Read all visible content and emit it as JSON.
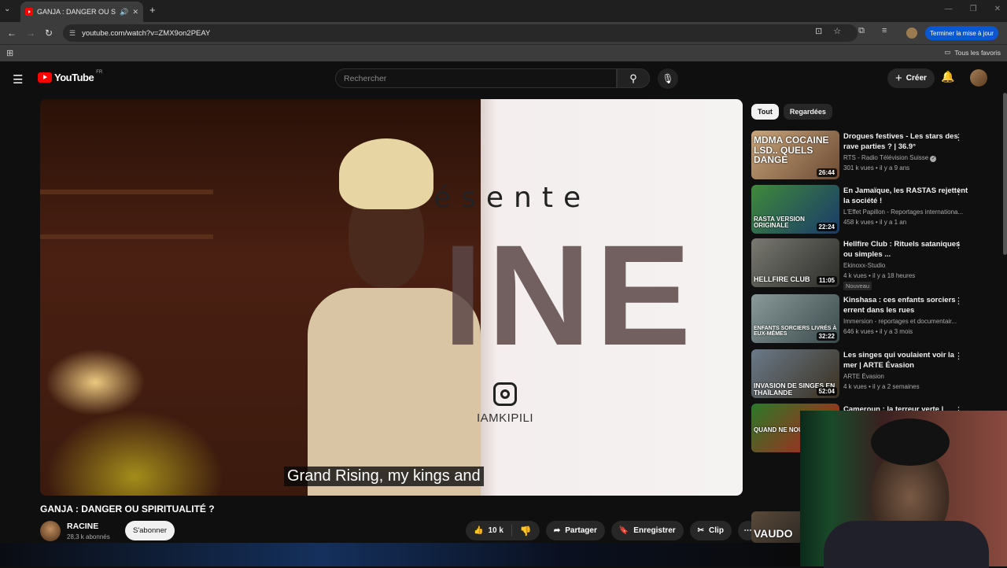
{
  "browser": {
    "tab_title": "GANJA : DANGER OU SPIRI",
    "url": "youtube.com/watch?v=ZMX9on2PEAY",
    "update_button": "Terminer la mise à jour",
    "bookmarks_all": "Tous les favoris"
  },
  "yt": {
    "logo_text": "YouTube",
    "logo_country": "FR",
    "search_placeholder": "Rechercher",
    "create_label": "Créer"
  },
  "video": {
    "overlay_text_top": "ésente",
    "overlay_text_big": "INE",
    "instagram_handle": "IAMKIPILI",
    "caption": "Grand Rising, my kings and",
    "title": "GANJA : DANGER OU SPIRITUALITÉ ?",
    "channel": "RACINE",
    "subscribers": "28,3 k abonnés",
    "subscribe_label": "S'abonner",
    "likes": "10 k",
    "share_label": "Partager",
    "save_label": "Enregistrer",
    "clip_label": "Clip"
  },
  "chips": [
    {
      "label": "Tout",
      "active": true
    },
    {
      "label": "Regardées",
      "active": false
    }
  ],
  "recommendations": [
    {
      "title": "Drogues festives - Les stars des rave parties ? | 36.9°",
      "channel": "RTS - Radio Télévision Suisse",
      "verified": true,
      "meta": "301 k vues • il y a 9 ans",
      "duration": "26:44",
      "thumb_text": "MDMA COCAINE LSD.. QUELS DANGE",
      "thumb_colors": [
        "#c9a57a",
        "#6a4a34"
      ]
    },
    {
      "title": "En Jamaïque, les RASTAS rejettent la société !",
      "channel": "L'Effet Papillon - Reportages internationa...",
      "verified": false,
      "meta": "458 k vues • il y a 1 an",
      "duration": "22:24",
      "thumb_text": "RASTA VERSION ORIGINALE",
      "thumb_colors": [
        "#3f8a3a",
        "#1a3a6a"
      ]
    },
    {
      "title": "Hellfire Club : Rituels sataniques ou simples ...",
      "channel": "Ekinoxx-Studio",
      "verified": false,
      "meta": "4 k vues • il y a 18 heures",
      "duration": "11:05",
      "badge": "Nouveau",
      "thumb_text": "HELLFIRE CLUB",
      "thumb_colors": [
        "#7a7a72",
        "#2a2a28"
      ]
    },
    {
      "title": "Kinshasa : ces enfants sorciers errent dans les rues",
      "channel": "Immersion - reportages et documentair...",
      "verified": false,
      "meta": "646 k vues • il y a 3 mois",
      "duration": "32:22",
      "thumb_text": "ENFANTS SORCIERS LIVRÉS À EUX-MÊMES",
      "thumb_colors": [
        "#8a9a9a",
        "#3a4a4a"
      ]
    },
    {
      "title": "Les singes qui voulaient voir la mer | ARTE Évasion",
      "channel": "ARTE Évasion",
      "verified": false,
      "meta": "4 k vues • il y a 2 semaines",
      "duration": "52:04",
      "thumb_text": "INVASION DE SINGES EN THAÏLANDE",
      "thumb_colors": [
        "#6a7a8a",
        "#3a3020"
      ]
    },
    {
      "title": "Cameroun : la terreur verte |",
      "channel": "",
      "verified": false,
      "meta": "",
      "duration": "",
      "thumb_text": "QUAND NE NOU",
      "thumb_colors": [
        "#2a7a2a",
        "#c01a1a"
      ]
    }
  ],
  "extra_thumb_text": "VAUDO"
}
